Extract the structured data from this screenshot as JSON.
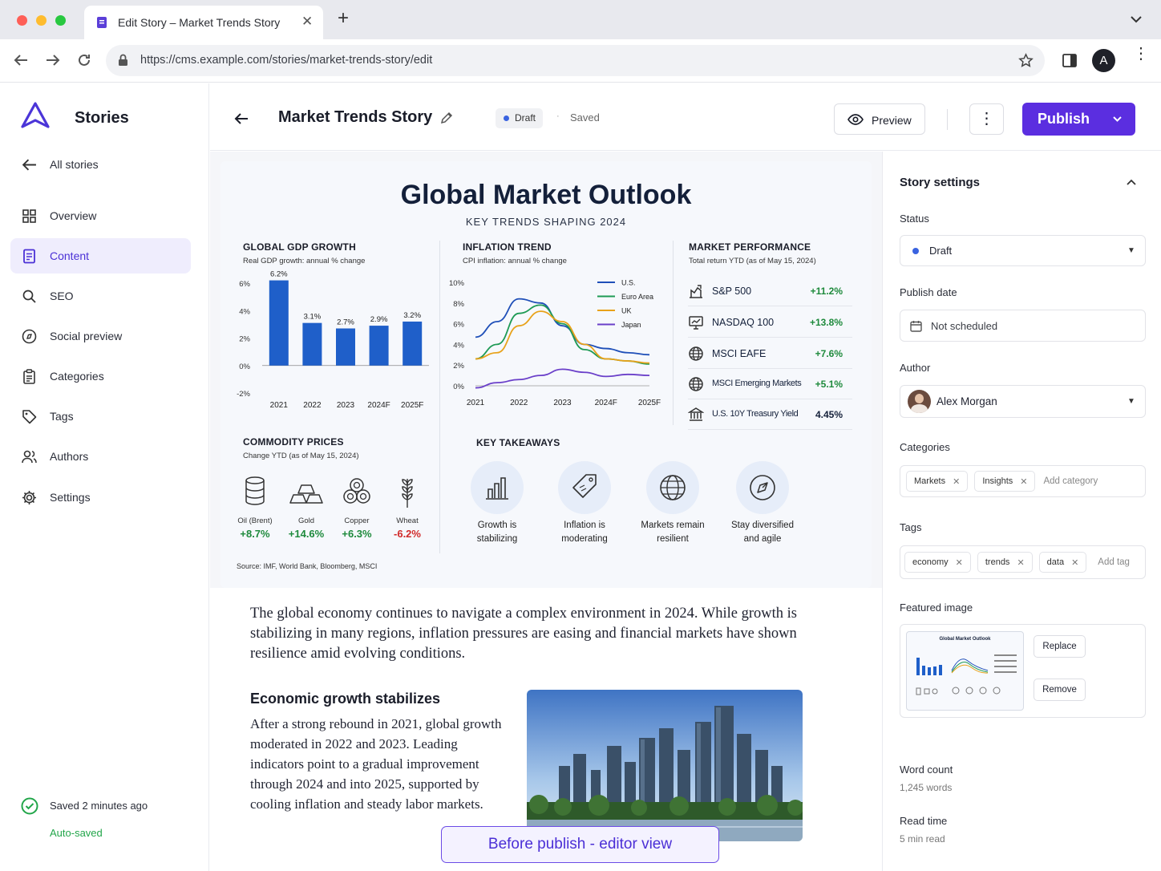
{
  "browser": {
    "tab_title": "Edit Story – Market Trends Story",
    "url": "https://cms.example.com/stories/market-trends-story/edit",
    "profile_initial": "A"
  },
  "app": {
    "name": "Stories",
    "back_label": "All stories"
  },
  "nav": [
    {
      "label": "Overview",
      "icon": "grid-icon"
    },
    {
      "label": "Content",
      "icon": "document-icon",
      "active": true
    },
    {
      "label": "SEO",
      "icon": "search-icon"
    },
    {
      "label": "Social preview",
      "icon": "compass-icon"
    },
    {
      "label": "Categories",
      "icon": "clipboard-icon"
    },
    {
      "label": "Tags",
      "icon": "tag-icon"
    },
    {
      "label": "Authors",
      "icon": "users-icon"
    },
    {
      "label": "Settings",
      "icon": "gear-icon"
    }
  ],
  "save_status": {
    "text": "Saved 2 minutes ago",
    "sub": "Auto-saved"
  },
  "header": {
    "title": "Market Trends Story",
    "badge": "Draft",
    "saved": "Saved",
    "preview": "Preview",
    "publish": "Publish"
  },
  "infographic": {
    "title": "Global Market Outlook",
    "subtitle": "KEY TRENDS SHAPING 2024",
    "source": "Source: IMF, World Bank, Bloomberg, MSCI",
    "gdp": {
      "heading": "GLOBAL GDP GROWTH",
      "sub": "Real GDP growth: annual % change",
      "y_ticks": [
        "6%",
        "4%",
        "2%",
        "0%",
        "-2%"
      ]
    },
    "inflation": {
      "heading": "INFLATION TREND",
      "sub": "CPI inflation: annual % change",
      "y_ticks": [
        "10%",
        "8%",
        "6%",
        "4%",
        "2%",
        "0%"
      ]
    },
    "performance": {
      "heading": "MARKET PERFORMANCE",
      "sub": "Total return YTD (as of May 15, 2024)",
      "rows": [
        {
          "name": "S&P 500",
          "value": "+11.2%",
          "icon": "chart-icon"
        },
        {
          "name": "NASDAQ 100",
          "value": "+13.8%",
          "icon": "monitor-icon"
        },
        {
          "name": "MSCI EAFE",
          "value": "+7.6%",
          "icon": "globe-icon"
        },
        {
          "name": "MSCI Emerging Markets",
          "value": "+5.1%",
          "icon": "globe-icon"
        },
        {
          "name": "U.S. 10Y Treasury Yield",
          "value": "4.45%",
          "icon": "bank-icon"
        }
      ]
    },
    "commodities": {
      "heading": "COMMODITY PRICES",
      "sub": "Change YTD (as of May 15, 2024)",
      "items": [
        {
          "name": "Oil (Brent)",
          "value": "+8.7%",
          "color": "#1e8a3c"
        },
        {
          "name": "Gold",
          "value": "+14.6%",
          "color": "#1e8a3c"
        },
        {
          "name": "Copper",
          "value": "+6.3%",
          "color": "#1e8a3c"
        },
        {
          "name": "Wheat",
          "value": "-6.2%",
          "color": "#d12a2a"
        }
      ]
    },
    "takeaways": {
      "heading": "KEY TAKEAWAYS",
      "items": [
        {
          "l1": "Growth is",
          "l2": "stabilizing"
        },
        {
          "l1": "Inflation is",
          "l2": "moderating"
        },
        {
          "l1": "Markets remain",
          "l2": "resilient"
        },
        {
          "l1": "Stay diversified",
          "l2": "and agile"
        }
      ]
    }
  },
  "chart_data": [
    {
      "type": "bar",
      "title": "GLOBAL GDP GROWTH",
      "subtitle": "Real GDP growth: annual % change",
      "categories": [
        "2021",
        "2022",
        "2023",
        "2024F",
        "2025F"
      ],
      "values": [
        6.2,
        3.1,
        2.7,
        2.9,
        3.2
      ],
      "data_labels": [
        "6.2%",
        "3.1%",
        "2.7%",
        "2.9%",
        "3.2%"
      ],
      "ylim": [
        -2,
        6
      ],
      "color": "#1f5fc9"
    },
    {
      "type": "line",
      "title": "INFLATION TREND",
      "subtitle": "CPI inflation: annual % change",
      "x": [
        "2021",
        "2021.5",
        "2022",
        "2022.5",
        "2023",
        "2023.5",
        "2024F",
        "2024.5",
        "2025F"
      ],
      "x_ticks": [
        "2021",
        "2022",
        "2023",
        "2024F",
        "2025F"
      ],
      "ylim": [
        0,
        10
      ],
      "legend": "top-right",
      "series": [
        {
          "name": "U.S.",
          "color": "#1f4fb8",
          "values": [
            4.7,
            6.2,
            8.4,
            8.0,
            5.8,
            4.0,
            3.6,
            3.2,
            3.0
          ]
        },
        {
          "name": "Euro Area",
          "color": "#1e9a55",
          "values": [
            2.6,
            4.0,
            7.0,
            7.8,
            6.0,
            3.5,
            2.6,
            2.4,
            2.1
          ]
        },
        {
          "name": "UK",
          "color": "#e8a21a",
          "values": [
            2.6,
            3.2,
            5.8,
            7.2,
            6.2,
            4.0,
            2.6,
            2.4,
            2.2
          ]
        },
        {
          "name": "Japan",
          "color": "#6a3fc9",
          "values": [
            -0.2,
            0.3,
            0.6,
            1.0,
            1.6,
            1.3,
            0.9,
            1.1,
            1.0
          ]
        }
      ]
    }
  ],
  "article": {
    "intro": "The global economy continues to navigate a complex environment in 2024. While growth is stabilizing in many regions, inflation pressures are easing and financial markets have shown resilience amid evolving conditions.",
    "h2": "Economic growth stabilizes",
    "p": "After a strong rebound in 2021, global growth moderated in 2022 and 2023. Leading indicators point to a gradual improvement through 2024 and into 2025, supported by cooling inflation and steady labor markets.",
    "banner": "Before publish - editor view"
  },
  "settings": {
    "title": "Story settings",
    "status_label": "Status",
    "status": "Draft",
    "date_label": "Publish date",
    "date": "Not scheduled",
    "author_label": "Author",
    "author": "Alex Morgan",
    "categories_label": "Categories",
    "categories": [
      "Markets",
      "Insights"
    ],
    "category_placeholder": "Add category",
    "tags_label": "Tags",
    "tags": [
      "economy",
      "trends",
      "data"
    ],
    "tag_placeholder": "Add tag",
    "image_label": "Featured image",
    "replace": "Replace",
    "remove": "Remove",
    "word_label": "Word count",
    "words": "1,245 words",
    "read_label": "Read time",
    "read": "5 min read",
    "thumb_title": "Global Market Outlook"
  },
  "colors": {
    "accent": "#5b2ee0",
    "bar": "#1f5fc9",
    "positive": "#1e8a3c",
    "negative": "#d12a2a"
  }
}
